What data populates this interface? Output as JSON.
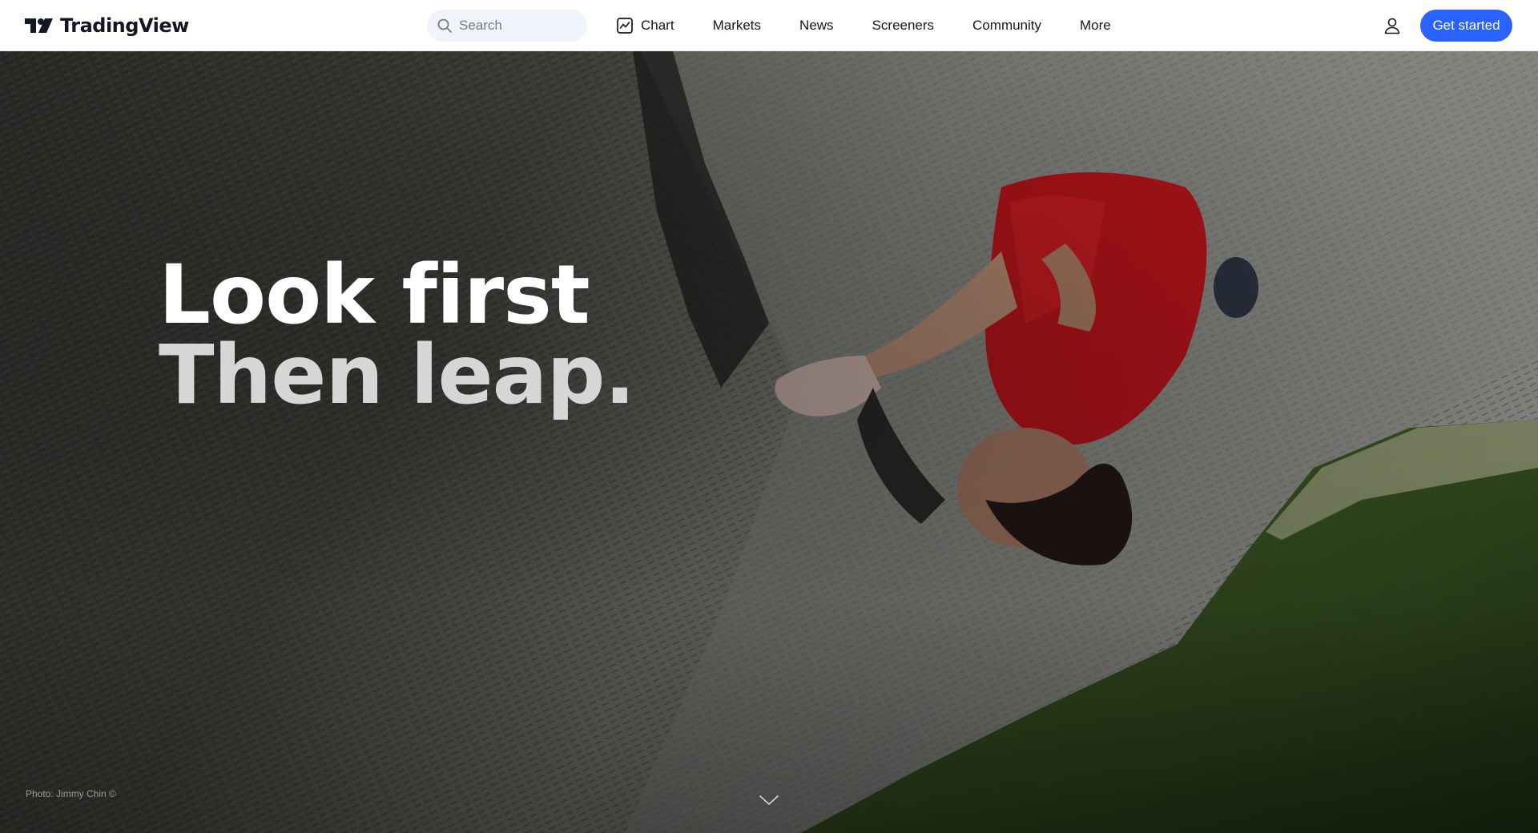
{
  "brand": {
    "name": "TradingView"
  },
  "search": {
    "placeholder": "Search"
  },
  "nav": {
    "items": [
      {
        "label": "Chart",
        "icon": "chart-icon"
      },
      {
        "label": "Markets"
      },
      {
        "label": "News"
      },
      {
        "label": "Screeners"
      },
      {
        "label": "Community"
      },
      {
        "label": "More"
      }
    ]
  },
  "header": {
    "user_icon": "user-icon",
    "cta_label": "Get started"
  },
  "hero": {
    "headline_line1": "Look first",
    "headline_line2": "Then leap.",
    "photo_credit": "Photo: Jimmy Chin ©",
    "scroll_icon": "chevron-down-icon"
  },
  "colors": {
    "accent": "#2962ff",
    "text": "#131722",
    "header_bg": "#ffffff",
    "search_bg": "#f0f3fa"
  }
}
